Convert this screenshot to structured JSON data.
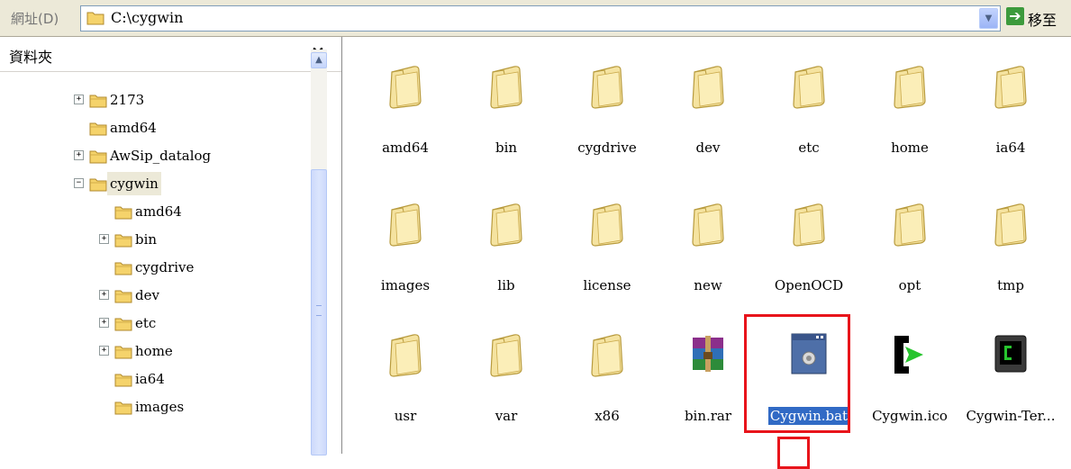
{
  "address_bar": {
    "label": "網址(D)",
    "path": "C:\\cygwin",
    "go_label": "移至",
    "dropdown_icon": "chevron-down-icon",
    "go_icon": "arrow-right-icon"
  },
  "folders_pane": {
    "title": "資料夾",
    "close": "×",
    "tree": [
      {
        "label": "2173",
        "expander": "+"
      },
      {
        "label": "amd64",
        "expander": ""
      },
      {
        "label": "AwSip_datalog",
        "expander": "+"
      },
      {
        "label": "cygwin",
        "expander": "−",
        "open": true,
        "selected": true
      },
      {
        "label": "amd64",
        "expander": ""
      },
      {
        "label": "bin",
        "expander": "+"
      },
      {
        "label": "cygdrive",
        "expander": ""
      },
      {
        "label": "dev",
        "expander": "+"
      },
      {
        "label": "etc",
        "expander": "+"
      },
      {
        "label": "home",
        "expander": "+"
      },
      {
        "label": "ia64",
        "expander": ""
      },
      {
        "label": "images",
        "expander": ""
      }
    ]
  },
  "files": [
    {
      "name": "amd64",
      "type": "folder"
    },
    {
      "name": "bin",
      "type": "folder"
    },
    {
      "name": "cygdrive",
      "type": "folder"
    },
    {
      "name": "dev",
      "type": "folder"
    },
    {
      "name": "etc",
      "type": "folder"
    },
    {
      "name": "home",
      "type": "folder"
    },
    {
      "name": "ia64",
      "type": "folder"
    },
    {
      "name": "images",
      "type": "folder"
    },
    {
      "name": "lib",
      "type": "folder"
    },
    {
      "name": "license",
      "type": "folder"
    },
    {
      "name": "new",
      "type": "folder"
    },
    {
      "name": "OpenOCD",
      "type": "folder"
    },
    {
      "name": "opt",
      "type": "folder"
    },
    {
      "name": "tmp",
      "type": "folder"
    },
    {
      "name": "usr",
      "type": "folder"
    },
    {
      "name": "var",
      "type": "folder"
    },
    {
      "name": "x86",
      "type": "folder"
    },
    {
      "name": "bin.rar",
      "type": "rar"
    },
    {
      "name": "Cygwin.bat",
      "type": "bat",
      "selected": true
    },
    {
      "name": "Cygwin.ico",
      "type": "ico"
    },
    {
      "name": "Cygwin-Ter...",
      "type": "terminal"
    }
  ],
  "colors": {
    "highlight": "#316ac5",
    "annotation": "#e8141b",
    "folder": "#f5e3a0"
  }
}
